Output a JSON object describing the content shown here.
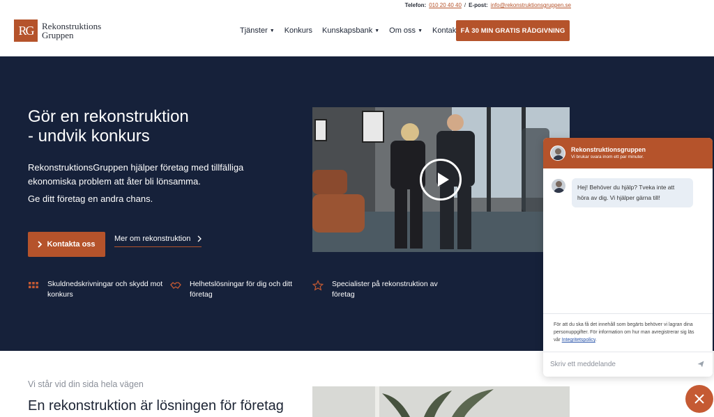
{
  "topbar": {
    "phone_label": "Telefon:",
    "phone": "010 20 40 40",
    "separator": "/",
    "email_label": "E-post:",
    "email": "info@rekonstruktionsgruppen.se"
  },
  "header": {
    "logo_mark": "RG",
    "logo_line1": "Rekonstruktions",
    "logo_line2": "Gruppen",
    "nav": [
      "Tjänster",
      "Konkurs",
      "Kunskapsbank",
      "Om oss",
      "Kontakt"
    ],
    "cta": "FÅ 30 MIN GRATIS RÅDGIVNING"
  },
  "hero": {
    "title_line1": "Gör en rekonstruktion",
    "title_line2": "- undvik konkurs",
    "lead": "RekonstruktionsGruppen hjälper företag med tillfälliga ekonomiska problem att åter bli lönsamma.",
    "lead2": "Ge ditt företag en andra chans.",
    "contact_button": "Kontakta oss",
    "more_link": "Mer om rekonstruktion",
    "features": [
      {
        "icon": "grid-icon",
        "text": "Skuldnedskrivningar och skydd mot konkurs"
      },
      {
        "icon": "handshake-icon",
        "text": "Helhetslösningar för dig och ditt företag"
      },
      {
        "icon": "star-icon",
        "text": "Specialister på rekonstruktion av företag"
      }
    ]
  },
  "lower": {
    "kicker": "Vi står vid din sida hela vägen",
    "title": "En rekonstruktion är lösningen för företag"
  },
  "chat": {
    "title": "Rekonstruktionsgruppen",
    "subtitle": "Vi brukar svara inom ett par minuter.",
    "message": "Hej! Behöver du hjälp? Tveka inte att höra av dig. Vi hjälper gärna till!",
    "privacy_text": "För att du ska få det innehåll som begärts behöver vi lagran dina personuppgifter. För information om hur man avregistrerar sig läs vår",
    "privacy_link": "Integritetspolicy",
    "privacy_end": ".",
    "input_placeholder": "Skriv ett meddelande"
  },
  "colors": {
    "accent": "#b5532b",
    "hero_bg": "#16213a"
  }
}
